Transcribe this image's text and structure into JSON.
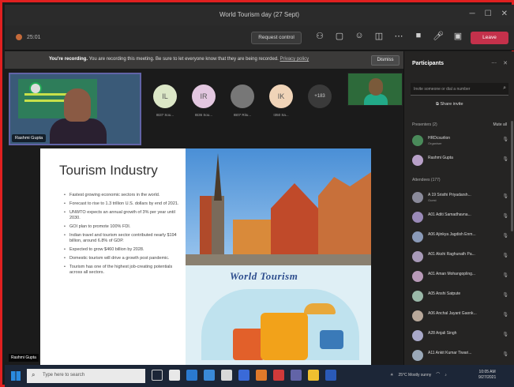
{
  "window": {
    "title": "World Tourism day (27 Sept)"
  },
  "toolbar": {
    "timer": "25:01",
    "request_control": "Request control",
    "leave": "Leave"
  },
  "banner": {
    "title": "You're recording.",
    "message": "You are recording this meeting. Be sure to let everyone know that they are being recorded.",
    "link": "Privacy policy",
    "dismiss": "Dismiss"
  },
  "self_video": {
    "name": "Rashmi Gupta"
  },
  "attendees": [
    {
      "initials": "IL",
      "label": "IB37 Sou...",
      "color": "#dce7c7"
    },
    {
      "initials": "IR",
      "label": "IB36 Sou...",
      "color": "#e3c7e0"
    },
    {
      "initials": "",
      "label": "IB07 Ritu...",
      "color": "#777777"
    },
    {
      "initials": "IK",
      "label": "I350 Sa...",
      "color": "#f0d4b8"
    },
    {
      "initials": "+183",
      "label": "",
      "color": "#3a3a3a"
    }
  ],
  "slide": {
    "title": "Tourism Industry",
    "bullets": [
      "Fastest growing economic sectors in the world.",
      "Forecast to rise to 1.3 trillion U.S. dollars by end of 2021.",
      "UNWTO expects an annual growth of 3% per year until 2030.",
      "GOI plan to promote 100% FDI.",
      "Indian travel and tourism sector contributed nearly $194 billion, around 6.8% of GDP.",
      "Expected to grow $460 billion by 2028.",
      "Domestic tourism will drive a growth post pandemic.",
      "Tourism has one of the highest job-creating potentials across all sectors."
    ],
    "image_caption": "World Tourism"
  },
  "speaker_tag": "Rashmi Gupta",
  "panel": {
    "title": "Participants",
    "search_placeholder": "Invite someone or dial a number",
    "share_invite": "Share invite",
    "presenters_label": "Presenters (2)",
    "mute_all": "Mute all",
    "presenters": [
      {
        "name": "HRDcsurlion",
        "sub": "Organiser",
        "color": "#4a8a5a"
      },
      {
        "name": "Rashmi Gupta",
        "sub": "",
        "color": "#b8a0c8"
      }
    ],
    "attendees_label": "Attendees (177)",
    "attendees": [
      {
        "name": "A 19 Sristhi Priyadarsh...",
        "sub": "Guest",
        "color": "#8a8a9a"
      },
      {
        "name": "A01 Aditi Samadhavna...",
        "sub": "",
        "color": "#9a8ab8"
      },
      {
        "name": "A06 Ajinkya Jagdish Enm...",
        "sub": "",
        "color": "#8a9ab8"
      },
      {
        "name": "A01 Akshi Raghunath Pa...",
        "sub": "",
        "color": "#a89ab8"
      },
      {
        "name": "A01 Aman Mohangopling...",
        "sub": "",
        "color": "#b89ab8"
      },
      {
        "name": "A05 Anshi Satpute",
        "sub": "",
        "color": "#9ab8a8"
      },
      {
        "name": "A06 Anchal Jayant Gaonk...",
        "sub": "",
        "color": "#b8a89a"
      },
      {
        "name": "A28 Anjali Singh",
        "sub": "",
        "color": "#a8a8c8"
      },
      {
        "name": "A11 Ankit Kumar Tiwari...",
        "sub": "",
        "color": "#9aa8b8"
      }
    ]
  },
  "taskbar": {
    "search_placeholder": "Type here to search",
    "tray_text": "25°C Mostly sunny",
    "time": "10:05 AM",
    "date": "9/27/2021"
  }
}
